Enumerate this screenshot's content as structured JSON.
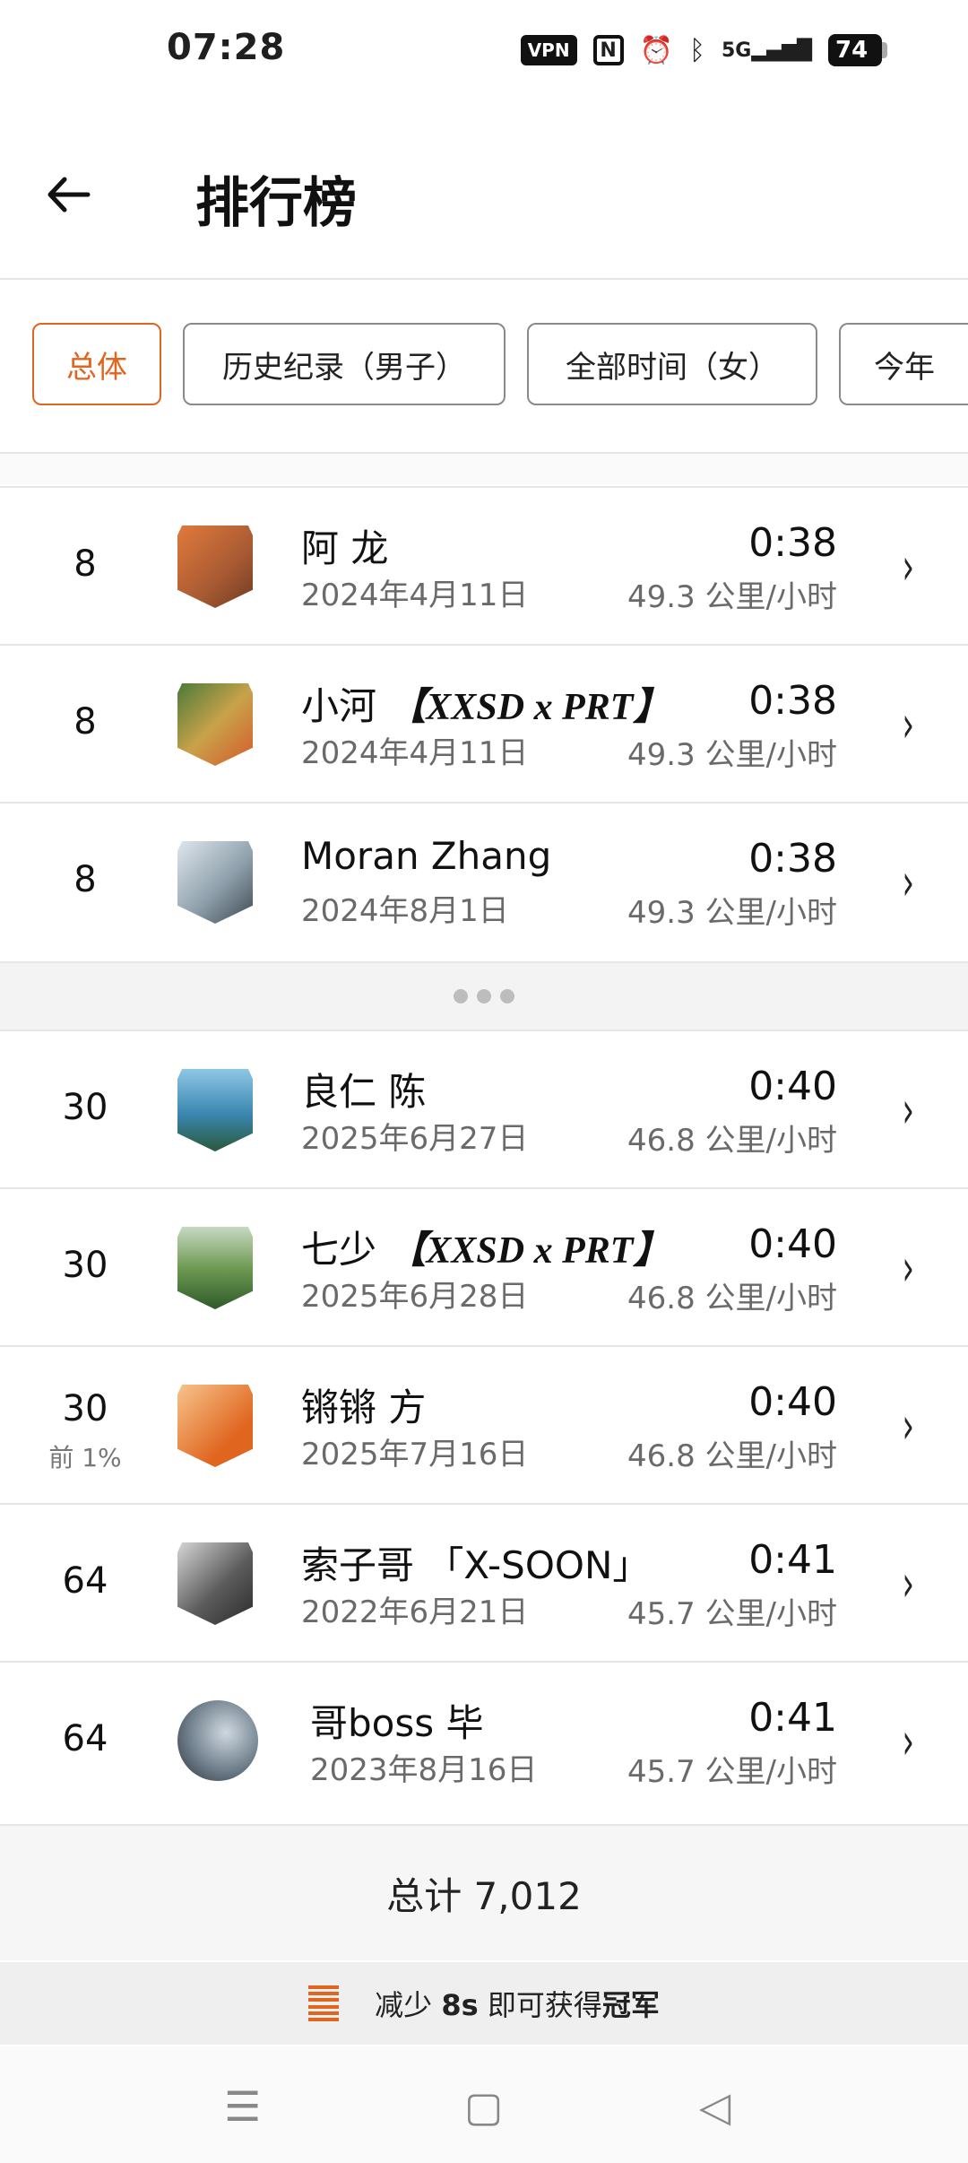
{
  "status_bar": {
    "time": "07:28",
    "vpn": "VPN",
    "nfc": "N",
    "alarm_icon": "alarm-icon",
    "bluetooth_icon": "bluetooth-icon",
    "network": "5G",
    "battery": "74"
  },
  "header": {
    "title": "排行榜",
    "back_icon": "arrow-left-icon"
  },
  "filters": [
    {
      "label": "总体",
      "active": true
    },
    {
      "label": "历史纪录（男子）",
      "active": false
    },
    {
      "label": "全部时间（女）",
      "active": false
    },
    {
      "label": "今年",
      "active": false
    }
  ],
  "entries": [
    {
      "rank": "8",
      "name": "阿 龙",
      "tag": "",
      "date": "2024年4月11日",
      "time": "0:38",
      "speed": "49.3 公里/小时"
    },
    {
      "rank": "8",
      "name": "小河 ",
      "tag": "【XXSD x PRT】",
      "date": "2024年4月11日",
      "time": "0:38",
      "speed": "49.3 公里/小时"
    },
    {
      "rank": "8",
      "name": "Moran Zhang",
      "tag": "",
      "date": "2024年8月1日",
      "time": "0:38",
      "speed": "49.3 公里/小时"
    },
    {
      "rank": "30",
      "name": "良仁 陈",
      "tag": "",
      "date": "2025年6月27日",
      "time": "0:40",
      "speed": "46.8 公里/小时"
    },
    {
      "rank": "30",
      "name": "七少 ",
      "tag": "【XXSD x PRT】",
      "date": "2025年6月28日",
      "time": "0:40",
      "speed": "46.8 公里/小时"
    },
    {
      "rank": "30",
      "percentile": "前 1%",
      "name": "锵锵 方",
      "tag": "",
      "date": "2025年7月16日",
      "time": "0:40",
      "speed": "46.8 公里/小时"
    },
    {
      "rank": "64",
      "name": "索子哥 「X-SOON」",
      "tag": "",
      "date": "2022年6月21日",
      "time": "0:41",
      "speed": "45.7 公里/小时"
    },
    {
      "rank": "64",
      "name": "哥boss 毕",
      "tag": "",
      "date": "2023年8月16日",
      "time": "0:41",
      "speed": "45.7 公里/小时"
    }
  ],
  "total_label": "总计 7,012",
  "cta": {
    "icon": "list-icon",
    "prefix": "减少 ",
    "amount": "8s",
    "middle": " 即可获得",
    "goal": "冠军"
  },
  "nav": {
    "menu_icon": "menu-icon",
    "home_icon": "home-square-icon",
    "back_icon": "back-triangle-icon"
  },
  "colors": {
    "accent": "#e0651f"
  }
}
